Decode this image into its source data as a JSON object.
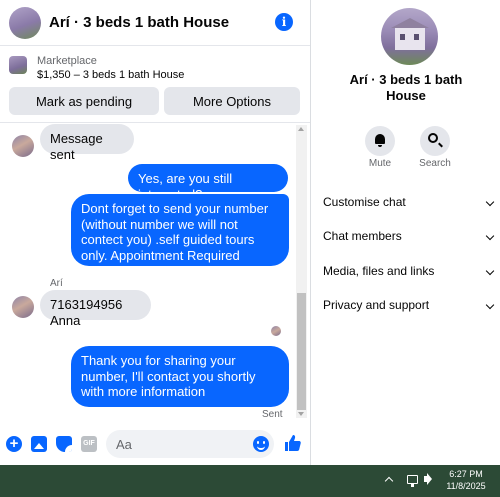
{
  "chat": {
    "title": "Arí · 3 beds 1 bath House",
    "marketplace": {
      "label": "Marketplace",
      "listing": "$1,350 – 3 beds 1 bath House"
    },
    "buttons": {
      "pending": "Mark as pending",
      "more": "More Options"
    },
    "messages": [
      {
        "direction": "in",
        "text": "Message sent"
      },
      {
        "direction": "out",
        "text": "Yes, are you still interested?"
      },
      {
        "direction": "out",
        "text": "Dont forget to send your number (without number we will not contect you) .self guided tours only. Appointment Required"
      },
      {
        "direction": "in",
        "sender": "Arí",
        "text": "7163194956 Anna"
      },
      {
        "direction": "out",
        "text": "Thank you for sharing your number, I'll contact you shortly with more information"
      }
    ],
    "status": "Sent",
    "composer": {
      "placeholder": "Aa",
      "gif_label": "GIF"
    }
  },
  "info_panel": {
    "name": "Arí · 3 beds 1 bath House",
    "actions": [
      {
        "label": "Mute",
        "icon": "bell-icon"
      },
      {
        "label": "Search",
        "icon": "search-icon"
      }
    ],
    "sections": [
      "Customise chat",
      "Chat members",
      "Media, files and links",
      "Privacy and support"
    ]
  },
  "taskbar": {
    "time": "6:27 PM",
    "date": "11/8/2025"
  },
  "colors": {
    "accent": "#0866ff",
    "bubble_in": "#e4e6eb",
    "taskbar": "#2c4a36"
  }
}
